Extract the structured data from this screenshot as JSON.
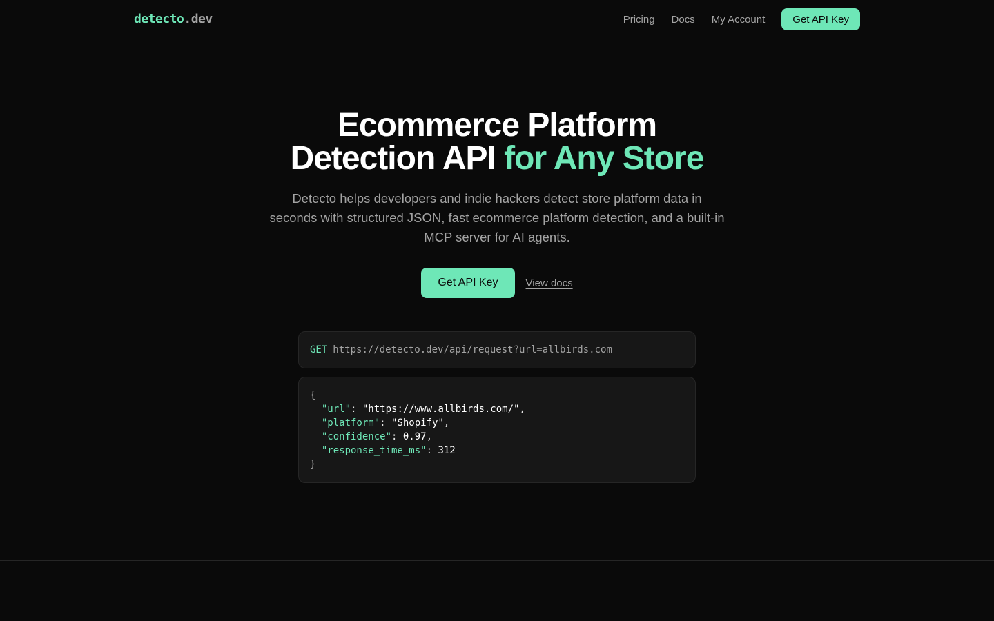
{
  "header": {
    "logo_main": "detecto",
    "logo_tld": ".dev",
    "nav": {
      "pricing": "Pricing",
      "docs": "Docs",
      "account": "My Account",
      "cta": "Get API Key"
    }
  },
  "hero": {
    "title_line1": "Ecommerce Platform",
    "title_line2_plain": "Detection API",
    "title_line2_accent": "for Any Store",
    "subtitle": "Detecto helps developers and indie hackers detect store platform data in seconds with structured JSON, fast ecommerce platform detection, and a built-in MCP server for AI agents.",
    "primary_cta": "Get API Key",
    "secondary_cta": "View docs"
  },
  "request": {
    "method": "GET",
    "url": "https://detecto.dev/api/request?url=allbirds.com"
  },
  "response": {
    "open_brace": "{",
    "close_brace": "}",
    "fields": [
      {
        "key": "\"url\"",
        "value": "\"https://www.allbirds.com/\"",
        "trail": ","
      },
      {
        "key": "\"platform\"",
        "value": "\"Shopify\"",
        "trail": ","
      },
      {
        "key": "\"confidence\"",
        "value": "0.97",
        "trail": ","
      },
      {
        "key": "\"response_time_ms\"",
        "value": "312",
        "trail": ""
      }
    ]
  },
  "colors": {
    "background": "#0a0a0a",
    "accent": "#6ee7b7",
    "muted_text": "#a3a3a3",
    "panel": "#171717",
    "border": "#262626"
  }
}
